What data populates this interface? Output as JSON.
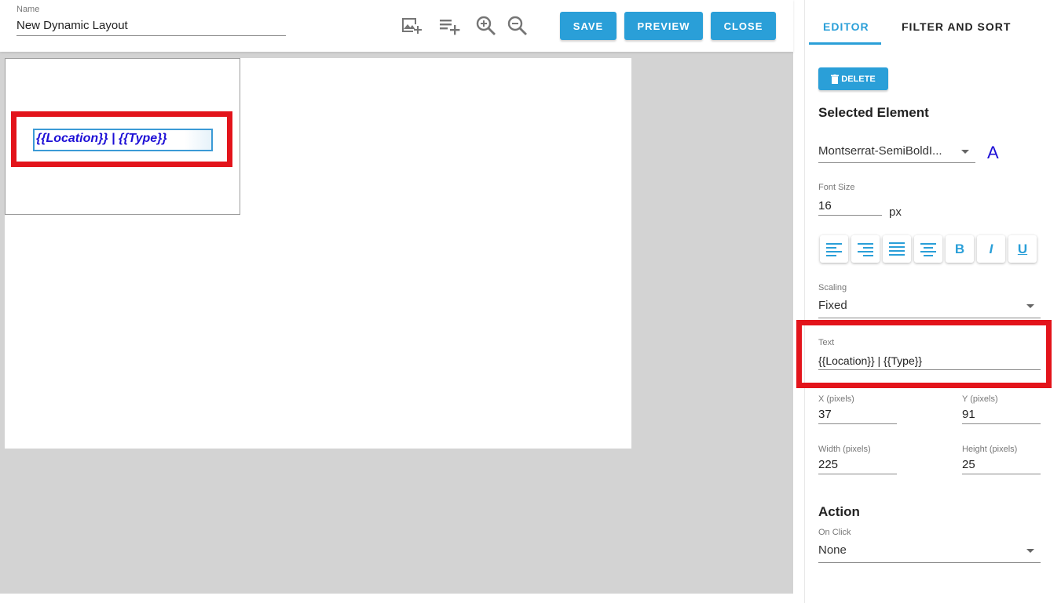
{
  "header": {
    "name_label": "Name",
    "name_value": "New Dynamic Layout",
    "icons": [
      "add-image-icon",
      "add-text-icon",
      "zoom-in-icon",
      "zoom-out-icon"
    ],
    "save_label": "SAVE",
    "preview_label": "PREVIEW",
    "close_label": "CLOSE"
  },
  "canvas": {
    "element_text": "{{Location}} | {{Type}}"
  },
  "panel": {
    "tabs": [
      {
        "label": "EDITOR",
        "active": true
      },
      {
        "label": "FILTER AND SORT",
        "active": false
      }
    ],
    "delete_label": "DELETE",
    "selected_element_title": "Selected Element",
    "font_family": "Montserrat-SemiBoldI...",
    "font_color_glyph": "A",
    "font_color": "#1d0fd6",
    "font_size_label": "Font Size",
    "font_size_value": "16",
    "font_size_unit": "px",
    "format_buttons": [
      "align-left-icon",
      "align-right-icon",
      "align-justify-icon",
      "align-center-icon",
      "bold-icon",
      "italic-icon",
      "underline-icon"
    ],
    "scaling_label": "Scaling",
    "scaling_value": "Fixed",
    "text_label": "Text",
    "text_value": "{{Location}} | {{Type}}",
    "x_label": "X (pixels)",
    "x_value": "37",
    "y_label": "Y (pixels)",
    "y_value": "91",
    "width_label": "Width (pixels)",
    "width_value": "225",
    "height_label": "Height (pixels)",
    "height_value": "25",
    "action_title": "Action",
    "on_click_label": "On Click",
    "on_click_value": "None"
  },
  "colors": {
    "accent": "#2a9fd8",
    "highlight": "#e3141b",
    "workarea": "#d3d3d3"
  }
}
